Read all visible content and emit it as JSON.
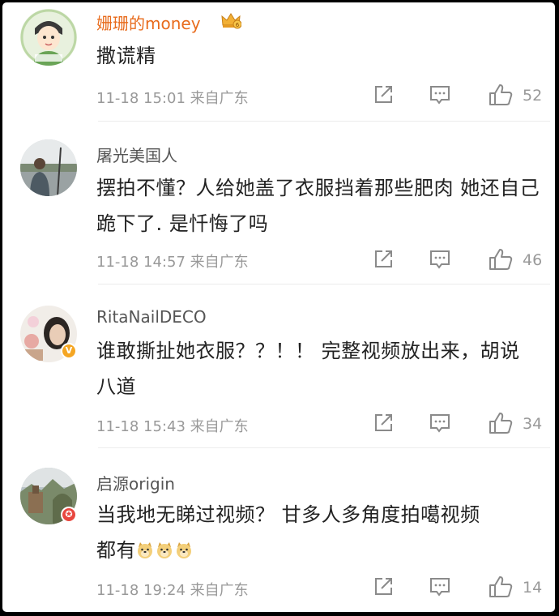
{
  "comments": [
    {
      "username": "姗珊的money",
      "text": "撒谎精",
      "time": "11-18 15:01",
      "location": "来自广东",
      "likes": "52",
      "vip": true
    },
    {
      "username": "屠光美国人",
      "text": "摆拍不懂？人给她盖了衣服挡着那些肥肉 她还自己跪下了. 是忏悔了吗",
      "time": "11-18 14:57",
      "location": "来自广东",
      "likes": "46"
    },
    {
      "username": "RitaNailDECO",
      "text": "谁敢撕扯她衣服？？！！ 完整视频放出来，胡说八道",
      "time": "11-18 15:43",
      "location": "来自广东",
      "likes": "34",
      "badge": "V"
    },
    {
      "username": "启源origin",
      "text_line1": "当我地无睇过视频？ 甘多人多角度拍噶视频",
      "text_line2": "都有",
      "emoji_count": 3,
      "time": "11-18 19:24",
      "location": "来自广东",
      "likes": "14",
      "badge": "✪"
    }
  ],
  "colors": {
    "vip_name": "#e86b1c",
    "name": "#555555",
    "meta": "#999999",
    "icon": "#8a8a8a",
    "verified": "#f5a623",
    "red_badge": "#e8473f"
  },
  "icons": [
    "share-icon",
    "comment-icon",
    "like-icon",
    "crown-icon",
    "doge-emoji"
  ]
}
